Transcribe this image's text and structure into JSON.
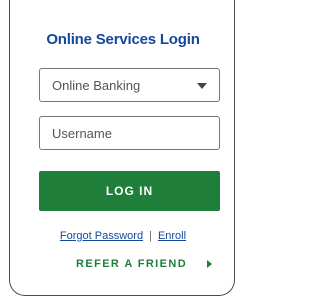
{
  "login": {
    "title": "Online Services Login",
    "service_select": {
      "selected": "Online Banking"
    },
    "username": {
      "placeholder": "Username",
      "value": ""
    },
    "login_button": "LOG IN",
    "forgot_password": "Forgot Password",
    "separator": "|",
    "enroll": "Enroll",
    "refer_friend": "REFER A FRIEND"
  },
  "colors": {
    "title": "#14489c",
    "button": "#1e7e3a",
    "refer": "#1e7e3a"
  }
}
